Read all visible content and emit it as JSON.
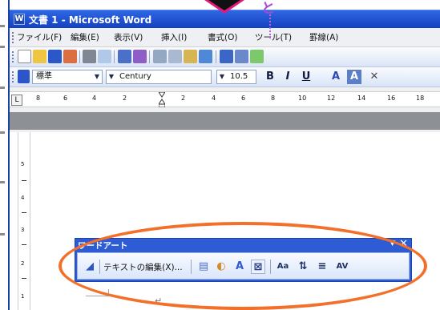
{
  "window": {
    "title": "文書 1 - Microsoft Word",
    "icon_text": "W"
  },
  "callout": {
    "label": "と"
  },
  "menubar": {
    "items": [
      "ファイル(F)",
      "編集(E)",
      "表示(V)",
      "挿入(I)",
      "書式(O)",
      "ツール(T)",
      "罫線(A)"
    ]
  },
  "toolbar_standard": {
    "icons": [
      "new-document-icon",
      "open-folder-icon",
      "save-icon",
      "permission-icon",
      "print-icon",
      "print-preview-icon",
      "spelling-icon",
      "research-icon",
      "cut-icon",
      "copy-icon",
      "paste-icon",
      "format-painter-icon",
      "undo-icon",
      "redo-icon",
      "hyperlink-icon"
    ]
  },
  "toolbar_formatting": {
    "style_value": "標準",
    "font_value": "Century",
    "size_value": "10.5",
    "bold": "B",
    "italic": "I",
    "underline": "U",
    "font_color_letter": "A",
    "highlight_letter": "A"
  },
  "ruler": {
    "tab_button": "L",
    "numbers": [
      "8",
      "6",
      "4",
      "2",
      "2",
      "4",
      "6",
      "8",
      "10",
      "12",
      "14",
      "16",
      "18"
    ],
    "vertical_numbers": [
      "5",
      "4",
      "3",
      "2",
      "1"
    ]
  },
  "wordart_toolbar": {
    "title": "ワードアート",
    "edit_text_label": "テキストの編集(X)...",
    "aa_label": "Aa",
    "spacing_label": "AV"
  }
}
